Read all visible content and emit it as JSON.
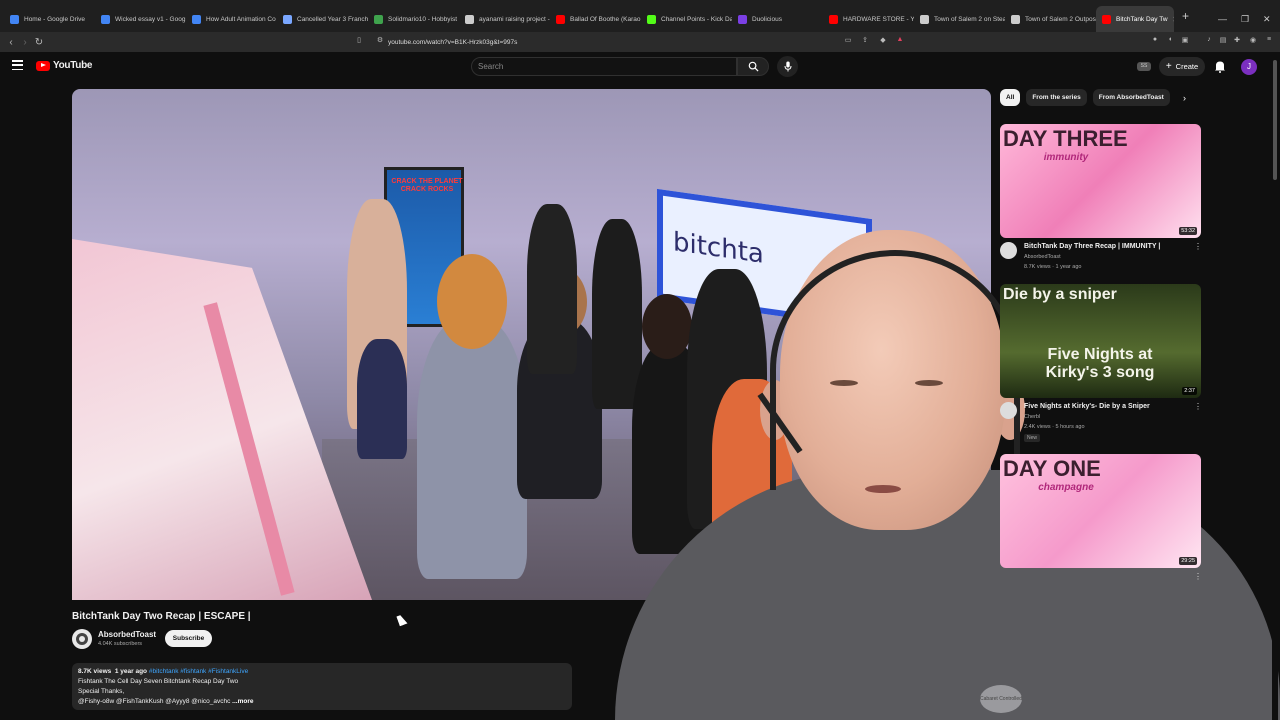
{
  "browser": {
    "tabs": [
      {
        "label": "Home - Google Drive",
        "color": "#4285f4"
      },
      {
        "label": "Wicked essay v1 - Goog",
        "color": "#4285f4"
      },
      {
        "label": "How Adult Animation Co",
        "color": "#4285f4"
      },
      {
        "label": "Cancelled Year 3 Franch",
        "color": "#7aa7ff"
      },
      {
        "label": "Solidmario10 - Hobbyist",
        "color": "#3fa34d"
      },
      {
        "label": "ayanami raising project -",
        "color": "#cccccc"
      },
      {
        "label": "Ballad Of Boothe (Karao",
        "color": "#ff0000"
      },
      {
        "label": "Channel Points - Kick Da",
        "color": "#53fc18"
      },
      {
        "label": "Duolicious",
        "color": "#7b3fe4"
      },
      {
        "label": "HARDWARE STORE - Yo",
        "color": "#ff0000"
      },
      {
        "label": "Town of Salem 2 on Stea",
        "color": "#cccccc"
      },
      {
        "label": "Town of Salem 2 Outpos",
        "color": "#cccccc"
      },
      {
        "label": "BitchTank Day Tw",
        "color": "#ff0000",
        "active": true
      }
    ],
    "new_tab": "+",
    "url": "youtube.com/watch?v=B1K-Hrzk03g&t=997s"
  },
  "yt": {
    "logo_text": "YouTube",
    "search_placeholder": "Search",
    "create_label": "Create",
    "ss_badge": "SS",
    "avatar_letter": "J"
  },
  "video": {
    "title": "BitchTank Day Two Recap | ESCAPE |",
    "channel": "AbsorbedToast",
    "subscribers": "4.04K subscribers",
    "subscribe_label": "Subscribe",
    "scene_tv_left": "CRACK THE PLANET CRACK ROCKS",
    "scene_tv_right": "bitchta",
    "description": {
      "views": "8.7K views",
      "age": "1 year ago",
      "tags": "#bitchtank #fishtank #FishtankLive",
      "line1": "Fishtank The Cell Day Seven Bitchtank Recap Day Two",
      "line2": "Special Thanks,",
      "line3": "@Fishy-o8w @FishTankKush @Ayyy8 @nico_avchc",
      "more": "...more"
    }
  },
  "sidebar": {
    "chips": [
      {
        "label": "All",
        "selected": true
      },
      {
        "label": "From the series",
        "selected": false
      },
      {
        "label": "From AbsorbedToast",
        "selected": false
      }
    ],
    "recommendations": [
      {
        "title": "BitchTank Day Three Recap | IMMUNITY |",
        "channel": "AbsorbedToast",
        "stats": "8.7K views · 1 year ago",
        "duration": "53:32",
        "thumb_text": "DAY THREE",
        "thumb_sub": "immunity"
      },
      {
        "title": "Five Nights at Kirky's- Die by a Sniper",
        "channel": "Cherbl",
        "stats": "2.4K views · 5 hours ago",
        "duration": "2:37",
        "badge": "New",
        "thumb_text": "Die by a sniper",
        "thumb_sub": "Five Nights at Kirky's 3 song"
      },
      {
        "title": "",
        "channel": "",
        "stats": "",
        "duration": "29:25",
        "thumb_text": "DAY ONE",
        "thumb_sub": "champagne"
      }
    ]
  },
  "overlay": {
    "shirt_logo": "Cabaret Controlled"
  }
}
